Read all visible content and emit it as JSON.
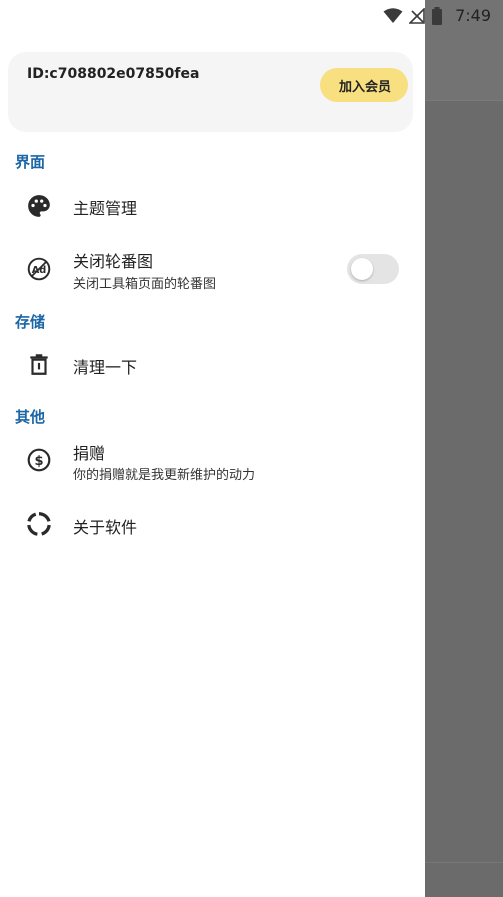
{
  "status_bar": {
    "time": "7:49",
    "icons": [
      "wifi-icon",
      "signal-icon",
      "battery-icon"
    ]
  },
  "drawer": {
    "account": {
      "id_text": "ID:c708802e07850fea",
      "vip_button_label": "加入会员"
    },
    "sections": {
      "interface": "界面",
      "storage": "存储",
      "other": "其他"
    },
    "items": {
      "theme": {
        "title": "主题管理",
        "icon": "palette-icon"
      },
      "banner": {
        "title": "关闭轮番图",
        "subtitle": "关闭工具箱页面的轮番图",
        "icon": "ad-off-icon",
        "toggle_on": false
      },
      "clean": {
        "title": "清理一下",
        "icon": "trash-icon"
      },
      "donate": {
        "title": "捐赠",
        "subtitle": "你的捐赠就是我更新维护的动力",
        "icon": "dollar-icon"
      },
      "about": {
        "title": "关于软件",
        "icon": "loading-ring-icon"
      }
    }
  },
  "colors": {
    "section_header": "#1b66a6",
    "vip_button": "#f8df80",
    "scrim": "#6b6b6b",
    "card": "#f5f5f5"
  }
}
